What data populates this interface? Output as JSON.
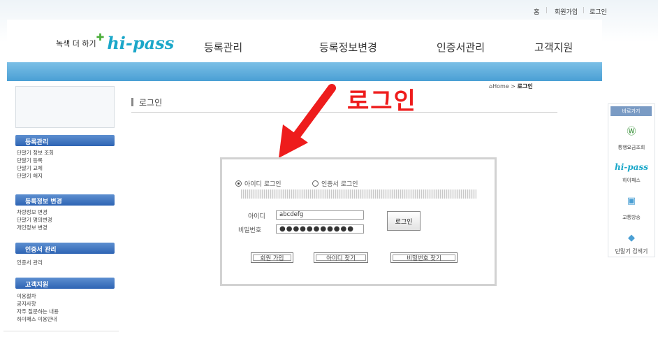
{
  "top_links": {
    "home": "홈",
    "signup": "회원가입",
    "login": "로그인"
  },
  "logo": {
    "slogan": "녹색 더 하기",
    "brand": "hi-pass"
  },
  "nav": [
    "등록관리",
    "등록정보변경",
    "인증서관리",
    "고객지원"
  ],
  "breadcrumb": {
    "home": "Home",
    "sep": " > ",
    "current": "로그인"
  },
  "page_title": "로그인",
  "annotation": "로그인",
  "sidebar": {
    "sections": [
      {
        "title": "등록관리",
        "items": [
          "단말기 정보 조회",
          "단말기 등록",
          "단말기 교체",
          "단말기 해지"
        ]
      },
      {
        "title": "등록정보 변경",
        "items": [
          "차량정보 변경",
          "단말기 명의변경",
          "개인정보 변경"
        ]
      },
      {
        "title": "인증서 관리",
        "items": [
          "인증서 관리"
        ]
      },
      {
        "title": "고객지원",
        "items": [
          "이용절차",
          "공지사항",
          "자주 질문하는 내용",
          "하이패스 이용안내"
        ]
      }
    ]
  },
  "login": {
    "radio_id": "아이디 로그인",
    "radio_cert": "인증서 로그인",
    "id_label": "아이디",
    "id_value": "abcdefg",
    "pw_label": "비밀번호",
    "pw_value": "●●●●●●●●●●●",
    "login_button": "로그인",
    "signup_button": "회원 가입",
    "find_id_button": "아이디 찾기",
    "find_pw_button": "비밀번호 찾기"
  },
  "quickbar": {
    "title": "바로가기",
    "items": [
      "통행요금조회",
      "하이패스",
      "교통방송",
      "단말기 검색기"
    ]
  },
  "colors": {
    "accent": "#4a9fd4",
    "annotation": "#ee1c1c",
    "brand": "#1aa7c9",
    "sidebar_header": "#2e64b4"
  }
}
